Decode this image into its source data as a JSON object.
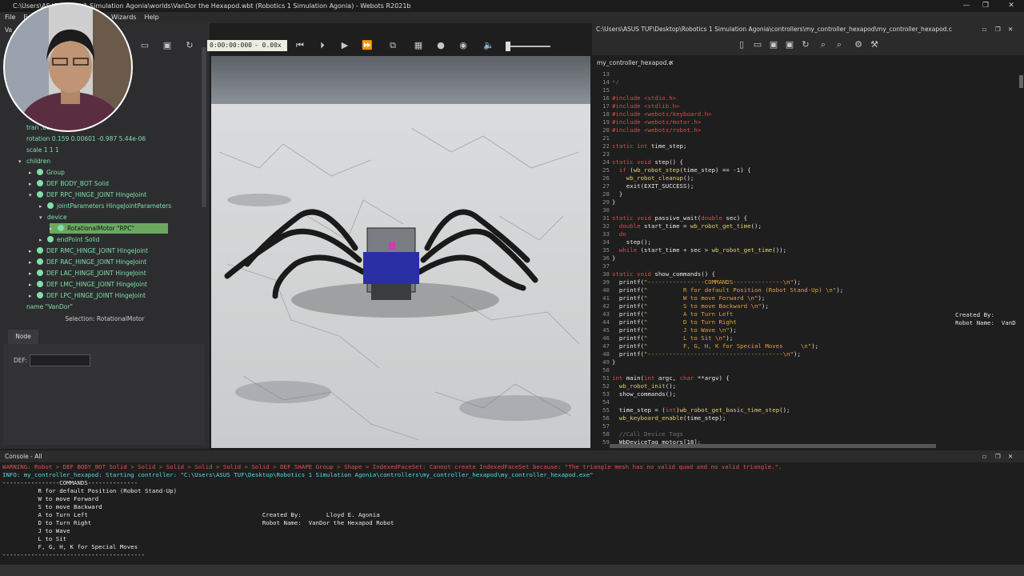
{
  "window": {
    "title": "C:\\Users\\ASUS TUF\\Desktop\\Robotics 1 Simulation Agonia\\worlds\\VanDor the Hexapod.wbt (Robotics 1 Simulation Agonia) - Webots R2021b",
    "title_visible": "C:\\Users\\AS   \\Robotics 1 Simulation Agonia\\worlds\\VanDor the Hexapod.wbt (Robotics 1 Simulation Agonia) - Webots R2021b"
  },
  "menu": [
    "File",
    "E",
    "ild",
    "Overlays",
    "Tools",
    "Wizards",
    "Help"
  ],
  "toolbar": {
    "time": "0:00:00:000",
    "speed": "-  0.00x"
  },
  "scene_tree": {
    "partial_label": "Va",
    "rows": [
      {
        "label": "tran               .6674 3.94e-07",
        "indent": 1,
        "dot": false
      },
      {
        "label": "rotation 0.159 0.00601 -0.987 5.44e-06",
        "indent": 1,
        "dot": false
      },
      {
        "label": "scale 1 1 1",
        "indent": 1,
        "dot": false
      },
      {
        "label": "children",
        "indent": 1,
        "dot": false,
        "arrow": "▾"
      },
      {
        "label": "Group",
        "indent": 2,
        "dot": true,
        "arrow": "▸"
      },
      {
        "label": "DEF BODY_BOT Solid",
        "indent": 2,
        "dot": true,
        "arrow": "▸"
      },
      {
        "label": "DEF RPC_HINGE_JOINT HingeJoint",
        "indent": 2,
        "dot": true,
        "arrow": "▾"
      },
      {
        "label": "jointParameters HingeJointParameters",
        "indent": 3,
        "dot": true,
        "arrow": "▸"
      },
      {
        "label": "device",
        "indent": 3,
        "dot": false,
        "arrow": "▾"
      },
      {
        "label": "RotationalMotor \"RPC\"",
        "indent": 4,
        "dot": true,
        "arrow": "▸",
        "selected": true
      },
      {
        "label": "endPoint Solid",
        "indent": 3,
        "dot": true,
        "arrow": "▸"
      },
      {
        "label": "DEF RMC_HINGE_JOINT HingeJoint",
        "indent": 2,
        "dot": true,
        "arrow": "▸"
      },
      {
        "label": "DEF RAC_HINGE_JOINT HingeJoint",
        "indent": 2,
        "dot": true,
        "arrow": "▸"
      },
      {
        "label": "DEF LAC_HINGE_JOINT HingeJoint",
        "indent": 2,
        "dot": true,
        "arrow": "▸"
      },
      {
        "label": "DEF LMC_HINGE_JOINT HingeJoint",
        "indent": 2,
        "dot": true,
        "arrow": "▸"
      },
      {
        "label": "DEF LPC_HINGE_JOINT HingeJoint",
        "indent": 2,
        "dot": true,
        "arrow": "▸"
      },
      {
        "label": "name \"VanDor\"",
        "indent": 1,
        "dot": false
      }
    ]
  },
  "selection_label": "Selection: RotationalMotor",
  "node_tab": "Node",
  "def_label": "DEF:",
  "def_value": "",
  "editor": {
    "path": "C:\\Users\\ASUS TUF\\Desktop\\Robotics 1 Simulation Agonia\\controllers\\my_controller_hexapod\\my_controller_hexapod.c",
    "tab_label": "my_controller_hexapod.c",
    "overflow_created_by": "Created By:",
    "overflow_robot_name": "Robot Name:  VanD",
    "lines": [
      {
        "n": "13",
        "t": [
          [
            "pl",
            ""
          ]
        ]
      },
      {
        "n": "14",
        "t": [
          [
            "cm",
            "*/"
          ]
        ]
      },
      {
        "n": "15",
        "t": [
          [
            "pl",
            ""
          ]
        ]
      },
      {
        "n": "16",
        "t": [
          [
            "inc",
            "#include <stdio.h>"
          ]
        ]
      },
      {
        "n": "17",
        "t": [
          [
            "inc",
            "#include <stdlib.h>"
          ]
        ]
      },
      {
        "n": "18",
        "t": [
          [
            "inc",
            "#include <webots/keyboard.h>"
          ]
        ]
      },
      {
        "n": "19",
        "t": [
          [
            "inc",
            "#include <webots/motor.h>"
          ]
        ]
      },
      {
        "n": "20",
        "t": [
          [
            "inc",
            "#include <webots/robot.h>"
          ]
        ]
      },
      {
        "n": "21",
        "t": [
          [
            "pl",
            ""
          ]
        ]
      },
      {
        "n": "22",
        "t": [
          [
            "kw",
            "static int "
          ],
          [
            "pl",
            "time_step;"
          ]
        ]
      },
      {
        "n": "23",
        "t": [
          [
            "pl",
            ""
          ]
        ]
      },
      {
        "n": "24",
        "t": [
          [
            "kw",
            "static void "
          ],
          [
            "pl",
            "step() {"
          ]
        ]
      },
      {
        "n": "25",
        "t": [
          [
            "kw",
            "  if "
          ],
          [
            "pl",
            "("
          ],
          [
            "fn",
            "wb_robot_step"
          ],
          [
            "pl",
            "(time_step) == -1) {"
          ]
        ]
      },
      {
        "n": "26",
        "t": [
          [
            "fn",
            "    wb_robot_cleanup"
          ],
          [
            "pl",
            "();"
          ]
        ]
      },
      {
        "n": "27",
        "t": [
          [
            "pl",
            "    exit(EXIT_SUCCESS);"
          ]
        ]
      },
      {
        "n": "28",
        "t": [
          [
            "pl",
            "  }"
          ]
        ]
      },
      {
        "n": "29",
        "t": [
          [
            "pl",
            "}"
          ]
        ]
      },
      {
        "n": "30",
        "t": [
          [
            "pl",
            ""
          ]
        ]
      },
      {
        "n": "31",
        "t": [
          [
            "kw",
            "static void "
          ],
          [
            "pl",
            "passive_wait("
          ],
          [
            "kw",
            "double "
          ],
          [
            "pl",
            "sec) {"
          ]
        ]
      },
      {
        "n": "32",
        "t": [
          [
            "kw",
            "  double "
          ],
          [
            "pl",
            "start_time = "
          ],
          [
            "fn",
            "wb_robot_get_time"
          ],
          [
            "pl",
            "();"
          ]
        ]
      },
      {
        "n": "33",
        "t": [
          [
            "kw",
            "  do"
          ]
        ]
      },
      {
        "n": "34",
        "t": [
          [
            "pl",
            "    step();"
          ]
        ]
      },
      {
        "n": "35",
        "t": [
          [
            "kw",
            "  while "
          ],
          [
            "pl",
            "(start_time + sec > "
          ],
          [
            "fn",
            "wb_robot_get_time"
          ],
          [
            "pl",
            "());"
          ]
        ]
      },
      {
        "n": "36",
        "t": [
          [
            "pl",
            "}"
          ]
        ]
      },
      {
        "n": "37",
        "t": [
          [
            "pl",
            ""
          ]
        ]
      },
      {
        "n": "38",
        "t": [
          [
            "kw",
            "static void "
          ],
          [
            "pl",
            "show_commands() {"
          ]
        ]
      },
      {
        "n": "39",
        "t": [
          [
            "pl",
            "  printf("
          ],
          [
            "str",
            "\"----------------COMMANDS--------------\\n\""
          ],
          [
            "pl",
            ");"
          ]
        ]
      },
      {
        "n": "40",
        "t": [
          [
            "pl",
            "  printf("
          ],
          [
            "str",
            "\"          R for default Position (Robot Stand-Up) \\n\""
          ],
          [
            "pl",
            ");"
          ]
        ]
      },
      {
        "n": "41",
        "t": [
          [
            "pl",
            "  printf("
          ],
          [
            "str",
            "\"          W to move Forward \\n\""
          ],
          [
            "pl",
            ");"
          ]
        ]
      },
      {
        "n": "42",
        "t": [
          [
            "pl",
            "  printf("
          ],
          [
            "str",
            "\"          S to move Backward \\n\""
          ],
          [
            "pl",
            ");"
          ]
        ]
      },
      {
        "n": "43",
        "t": [
          [
            "pl",
            "  printf("
          ],
          [
            "str",
            "\"          A to Turn Left"
          ],
          [
            "pl",
            ""
          ]
        ]
      },
      {
        "n": "44",
        "t": [
          [
            "pl",
            "  printf("
          ],
          [
            "str",
            "\"          D to Turn Right"
          ],
          [
            "pl",
            ""
          ]
        ]
      },
      {
        "n": "45",
        "t": [
          [
            "pl",
            "  printf("
          ],
          [
            "str",
            "\"          J to Wave \\n\""
          ],
          [
            "pl",
            ");"
          ]
        ]
      },
      {
        "n": "46",
        "t": [
          [
            "pl",
            "  printf("
          ],
          [
            "str",
            "\"          L to Sit \\n\""
          ],
          [
            "pl",
            ");"
          ]
        ]
      },
      {
        "n": "47",
        "t": [
          [
            "pl",
            "  printf("
          ],
          [
            "str",
            "\"          F, G, H, K for Special Moves     \\n\""
          ],
          [
            "pl",
            ");"
          ]
        ]
      },
      {
        "n": "48",
        "t": [
          [
            "pl",
            "  printf("
          ],
          [
            "str",
            "\"--------------------------------------\\n\""
          ],
          [
            "pl",
            ");"
          ]
        ]
      },
      {
        "n": "49",
        "t": [
          [
            "pl",
            "}"
          ]
        ]
      },
      {
        "n": "50",
        "t": [
          [
            "pl",
            ""
          ]
        ]
      },
      {
        "n": "51",
        "t": [
          [
            "kw",
            "int "
          ],
          [
            "pl",
            "main("
          ],
          [
            "kw",
            "int "
          ],
          [
            "pl",
            "argc, "
          ],
          [
            "kw",
            "char "
          ],
          [
            "pl",
            "**argv) {"
          ]
        ]
      },
      {
        "n": "52",
        "t": [
          [
            "fn",
            "  wb_robot_init"
          ],
          [
            "pl",
            "();"
          ]
        ]
      },
      {
        "n": "53",
        "t": [
          [
            "pl",
            "  show_commands();"
          ]
        ]
      },
      {
        "n": "54",
        "t": [
          [
            "pl",
            ""
          ]
        ]
      },
      {
        "n": "55",
        "t": [
          [
            "pl",
            "  time_step = ("
          ],
          [
            "kw",
            "int"
          ],
          [
            "pl",
            ")"
          ],
          [
            "fn",
            "wb_robot_get_basic_time_step"
          ],
          [
            "pl",
            "();"
          ]
        ]
      },
      {
        "n": "56",
        "t": [
          [
            "fn",
            "  wb_keyboard_enable"
          ],
          [
            "pl",
            "(time_step);"
          ]
        ]
      },
      {
        "n": "57",
        "t": [
          [
            "pl",
            ""
          ]
        ]
      },
      {
        "n": "58",
        "t": [
          [
            "cm",
            "  //Call Device Tags"
          ]
        ]
      },
      {
        "n": "59",
        "t": [
          [
            "pl",
            "  WbDeviceTag motors[18];"
          ]
        ]
      }
    ]
  },
  "console": {
    "title": "Console - All",
    "lines": [
      {
        "cls": "warn",
        "text": "WARNING: Robot > DEF BODY_BOT Solid > Solid > Solid > Solid > Solid > Solid > DEF SHAPE Group > Shape > IndexedFaceSet: Cannot create IndexedFaceSet because: \"The triangle mesh has no valid quad and no valid triangle.\"."
      },
      {
        "cls": "info",
        "text": "INFO: my_controller_hexapod: Starting controller: \"C:\\Users\\ASUS TUF\\Desktop\\Robotics 1 Simulation Agonia\\controllers\\my_controller_hexapod\\my_controller_hexapod.exe\""
      },
      {
        "cls": "",
        "text": "----------------COMMANDS--------------"
      },
      {
        "cls": "",
        "text": "          R for default Position (Robot Stand-Up)"
      },
      {
        "cls": "",
        "text": "          W to move Forward"
      },
      {
        "cls": "",
        "text": "          S to move Backward"
      },
      {
        "cls": "",
        "text": "          A to Turn Left                                                 Created By:       Lloyd E. Agonia"
      },
      {
        "cls": "",
        "text": "          D to Turn Right                                                Robot Name:  VanDor the Hexapod Robot"
      },
      {
        "cls": "",
        "text": "          J to Wave"
      },
      {
        "cls": "",
        "text": "          L to Sit"
      },
      {
        "cls": "",
        "text": "          F, G, H, K for Special Moves"
      },
      {
        "cls": "",
        "text": "----------------------------------------"
      }
    ]
  },
  "colors": {
    "tree_green": "#7fe0a8",
    "keyword_red": "#e04848",
    "warning_red": "#e05050",
    "info_cyan": "#5ad8e0"
  }
}
